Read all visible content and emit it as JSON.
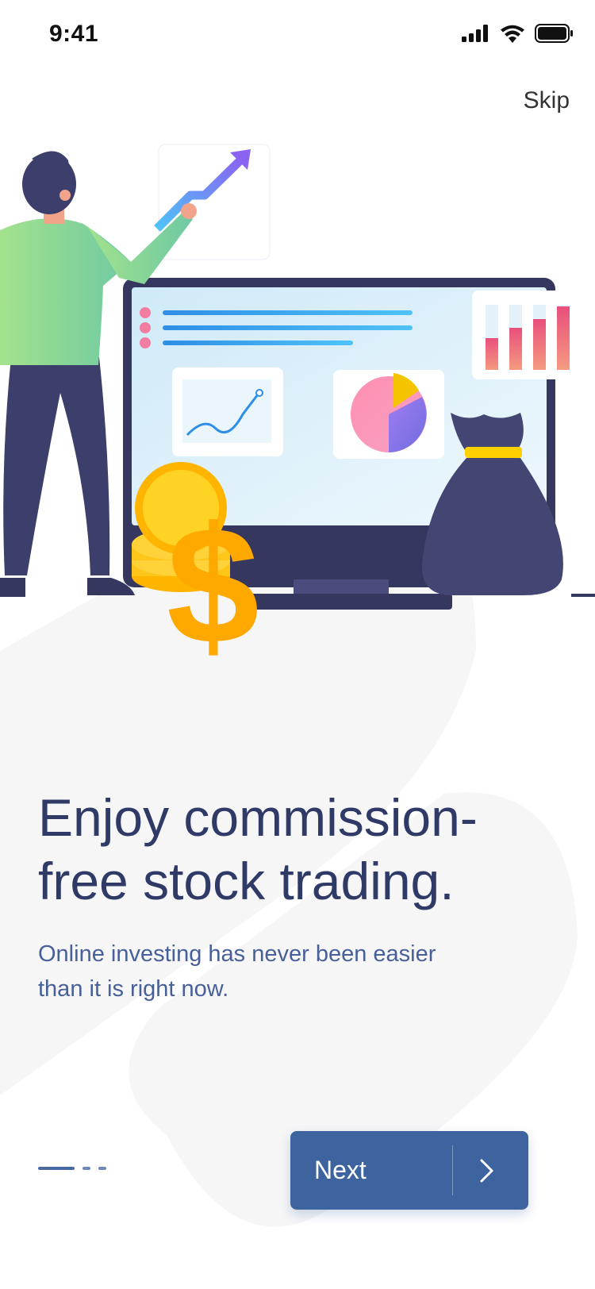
{
  "status_bar": {
    "time": "9:41",
    "icons": [
      "signal-icon",
      "wifi-icon",
      "battery-icon"
    ]
  },
  "header": {
    "skip_label": "Skip"
  },
  "illustration": {
    "subject": "stock-trading-illustration"
  },
  "content": {
    "headline": "Enjoy commission-free stock trading.",
    "subtitle": "Online investing has never been easier than it is right now."
  },
  "pager": {
    "total_pages": 3,
    "current_page": 1
  },
  "next_button": {
    "label": "Next",
    "icon": "chevron-right-icon"
  },
  "colors": {
    "primary": "#3e64a0",
    "headline": "#2f3a66",
    "subtitle": "#48609a",
    "background_shape": "#f7f7f8",
    "coin": "#ffa800",
    "bag": "#434573",
    "shirt": "#8edb99"
  }
}
